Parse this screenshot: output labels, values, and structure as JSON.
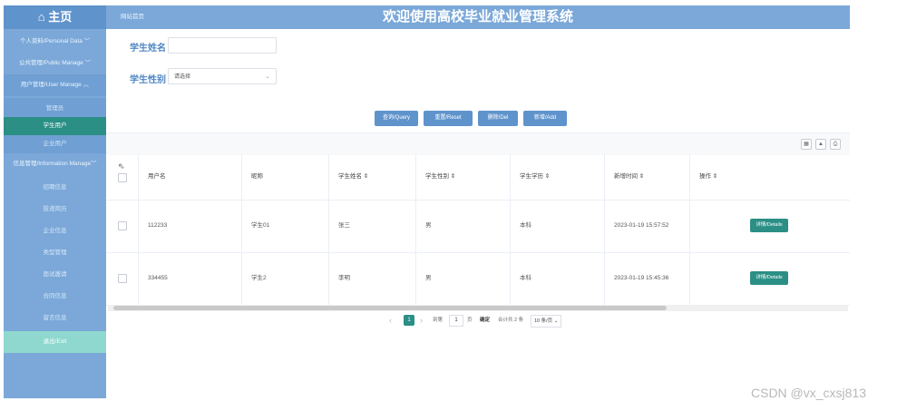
{
  "sidebar": {
    "logo_icon": "⌂",
    "logo_label": "主页",
    "items": [
      {
        "label": "个人资料/Personal Data  ﹀"
      },
      {
        "label": "公共管理/Public Manage  ﹀"
      },
      {
        "label": "用户管理/User Manage  ︿"
      },
      {
        "label": "管理员"
      },
      {
        "label": "学生用户"
      },
      {
        "label": "企业用户"
      },
      {
        "label": "信息管理/Information Manage﹀"
      },
      {
        "label": "招聘信息"
      },
      {
        "label": "投递简历"
      },
      {
        "label": "企业信息"
      },
      {
        "label": "类型管理"
      },
      {
        "label": "面试邀请"
      },
      {
        "label": "合同信息"
      },
      {
        "label": "留言信息"
      },
      {
        "label": "退出/Exit"
      }
    ]
  },
  "topbar": {
    "breadcrumb": "网站首页",
    "title": "欢迎使用高校毕业就业管理系统"
  },
  "search": {
    "name_label": "学生姓名",
    "name_value": "",
    "gender_label": "学生性别",
    "gender_placeholder": "请选择",
    "gender_caret": "⌄"
  },
  "buttons": {
    "query": "查询/Query",
    "reset": "重置/Reset",
    "delete": "删除/Del",
    "add": "新增/Add"
  },
  "toolbar_icons": [
    "grid-icon",
    "export-icon",
    "print-icon"
  ],
  "toolbar_glyphs": [
    "▦",
    "▲",
    "⎙"
  ],
  "table": {
    "headers": [
      "用户名",
      "昵称",
      "学生姓名 ⇕",
      "学生性别 ⇕",
      "学生学历 ⇕",
      "新增时间 ⇕",
      "操作 ⇕"
    ],
    "cursor_glyph": "⇖",
    "detail_label": "详情/Details",
    "rows": [
      {
        "username": "112233",
        "nickname": "学生01",
        "name": "张三",
        "gender": "男",
        "education": "本科",
        "created": "2023-01-19 15:57:52"
      },
      {
        "username": "334455",
        "nickname": "学生2",
        "name": "李明",
        "gender": "男",
        "education": "本科",
        "created": "2023-01-19 15:45:36"
      }
    ]
  },
  "pagination": {
    "prev": "‹",
    "current": "1",
    "next": "›",
    "goto_label": "到第",
    "goto_value": "1",
    "page_unit": "页",
    "confirm": "确定",
    "total": "合计共 2 条",
    "page_size": "10 条/页 ⌄"
  },
  "watermark": "CSDN @vx_cxsj813",
  "colors": {
    "primary": "#7ba8d8",
    "button": "#5f93cc",
    "teal": "#2b8f86"
  }
}
